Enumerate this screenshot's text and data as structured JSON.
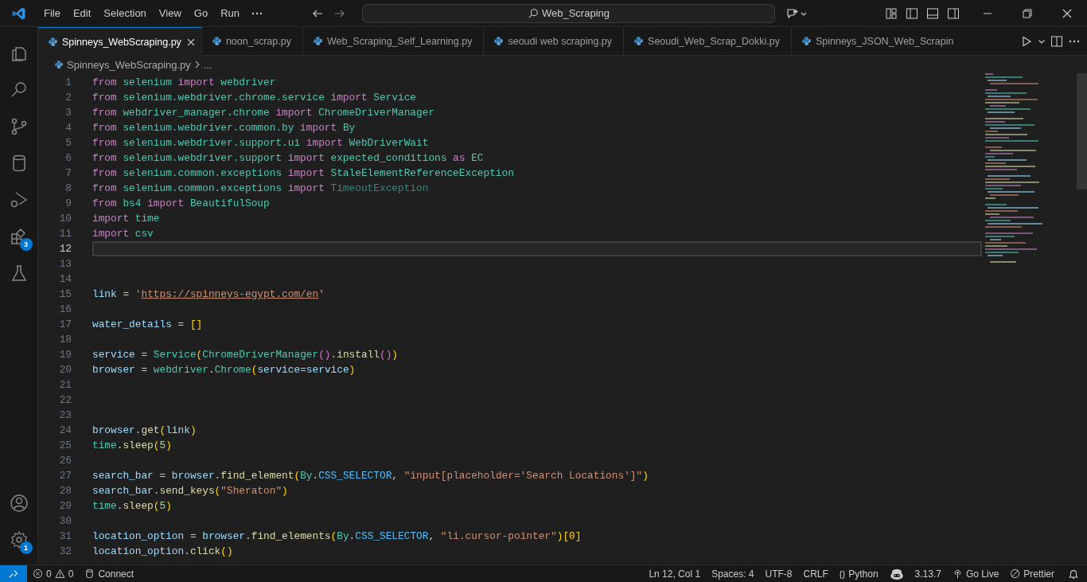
{
  "menu": [
    "File",
    "Edit",
    "Selection",
    "View",
    "Go",
    "Run"
  ],
  "search": {
    "value": "Web_Scraping"
  },
  "tabs": [
    {
      "label": "Spinneys_WebScraping.py",
      "selected": true
    },
    {
      "label": "noon_scrap.py",
      "selected": false
    },
    {
      "label": "Web_Scraping_Self_Learning.py",
      "selected": false
    },
    {
      "label": "seoudi web scraping.py",
      "selected": false
    },
    {
      "label": "Seoudi_Web_Scrap_Dokki.py",
      "selected": false
    },
    {
      "label": "Spinneys_JSON_Web_Scrapin",
      "selected": false
    }
  ],
  "breadcrumb": [
    "Spinneys_WebScraping.py",
    "..."
  ],
  "activity_badges": {
    "extensions": "3",
    "settings": "1"
  },
  "lines": [
    {
      "number": "1",
      "active": false,
      "tokens": [
        {
          "kind": "kw",
          "text": "from "
        },
        {
          "kind": "mod",
          "text": "selenium"
        },
        {
          "kind": "kw",
          "text": " import "
        },
        {
          "kind": "mod",
          "text": "webdriver"
        }
      ]
    },
    {
      "number": "2",
      "active": false,
      "tokens": [
        {
          "kind": "kw",
          "text": "from "
        },
        {
          "kind": "mod",
          "text": "selenium.webdriver.chrome.service"
        },
        {
          "kind": "kw",
          "text": " import "
        },
        {
          "kind": "mod",
          "text": "Service"
        }
      ]
    },
    {
      "number": "3",
      "active": false,
      "tokens": [
        {
          "kind": "kw",
          "text": "from "
        },
        {
          "kind": "mod",
          "text": "webdriver_manager.chrome"
        },
        {
          "kind": "kw",
          "text": " import "
        },
        {
          "kind": "mod",
          "text": "ChromeDriverManager"
        }
      ]
    },
    {
      "number": "4",
      "active": false,
      "tokens": [
        {
          "kind": "kw",
          "text": "from "
        },
        {
          "kind": "mod",
          "text": "selenium.webdriver.common.by"
        },
        {
          "kind": "kw",
          "text": " import "
        },
        {
          "kind": "mod",
          "text": "By"
        }
      ]
    },
    {
      "number": "5",
      "active": false,
      "tokens": [
        {
          "kind": "kw",
          "text": "from "
        },
        {
          "kind": "mod",
          "text": "selenium.webdriver.support.ui"
        },
        {
          "kind": "kw",
          "text": " import "
        },
        {
          "kind": "mod",
          "text": "WebDriverWait"
        }
      ]
    },
    {
      "number": "6",
      "active": false,
      "tokens": [
        {
          "kind": "kw",
          "text": "from "
        },
        {
          "kind": "mod",
          "text": "selenium.webdriver.support"
        },
        {
          "kind": "kw",
          "text": " import "
        },
        {
          "kind": "mod",
          "text": "expected_conditions"
        },
        {
          "kind": "kw",
          "text": " as "
        },
        {
          "kind": "mod",
          "text": "EC"
        }
      ]
    },
    {
      "number": "7",
      "active": false,
      "tokens": [
        {
          "kind": "kw",
          "text": "from "
        },
        {
          "kind": "mod",
          "text": "selenium.common.exceptions"
        },
        {
          "kind": "kw",
          "text": " import "
        },
        {
          "kind": "mod",
          "text": "StaleElementReferenceException"
        }
      ]
    },
    {
      "number": "8",
      "active": false,
      "tokens": [
        {
          "kind": "kw",
          "text": "from "
        },
        {
          "kind": "mod",
          "text": "selenium.common.exceptions"
        },
        {
          "kind": "kw",
          "text": " import "
        },
        {
          "kind": "dim",
          "text": "TimeoutException"
        }
      ]
    },
    {
      "number": "9",
      "active": false,
      "tokens": [
        {
          "kind": "kw",
          "text": "from "
        },
        {
          "kind": "mod",
          "text": "bs4"
        },
        {
          "kind": "kw",
          "text": " import "
        },
        {
          "kind": "mod",
          "text": "BeautifulSoup"
        }
      ]
    },
    {
      "number": "10",
      "active": false,
      "tokens": [
        {
          "kind": "kw",
          "text": "import "
        },
        {
          "kind": "mod",
          "text": "time"
        }
      ]
    },
    {
      "number": "11",
      "active": false,
      "tokens": [
        {
          "kind": "kw",
          "text": "import "
        },
        {
          "kind": "mod",
          "text": "csv"
        }
      ]
    },
    {
      "number": "12",
      "active": true
    },
    {
      "number": "13",
      "active": false
    },
    {
      "number": "14",
      "active": false
    },
    {
      "number": "15",
      "active": false,
      "tokens": [
        {
          "kind": "var",
          "text": "link"
        },
        {
          "kind": "op",
          "text": " = "
        },
        {
          "kind": "str",
          "text": "'"
        },
        {
          "kind": "url",
          "text": "https://spinneys-egypt.com/en"
        },
        {
          "kind": "str",
          "text": "'"
        }
      ]
    },
    {
      "number": "16",
      "active": false
    },
    {
      "number": "17",
      "active": false,
      "tokens": [
        {
          "kind": "var",
          "text": "water_details"
        },
        {
          "kind": "op",
          "text": " = "
        },
        {
          "kind": "p1",
          "text": "[]"
        }
      ]
    },
    {
      "number": "18",
      "active": false
    },
    {
      "number": "19",
      "active": false,
      "tokens": [
        {
          "kind": "var",
          "text": "service"
        },
        {
          "kind": "op",
          "text": " = "
        },
        {
          "kind": "mod",
          "text": "Service"
        },
        {
          "kind": "p1",
          "text": "("
        },
        {
          "kind": "mod",
          "text": "ChromeDriverManager"
        },
        {
          "kind": "p2",
          "text": "()"
        },
        {
          "kind": "op",
          "text": "."
        },
        {
          "kind": "fn",
          "text": "install"
        },
        {
          "kind": "p2",
          "text": "()"
        },
        {
          "kind": "p1",
          "text": ")"
        }
      ]
    },
    {
      "number": "20",
      "active": false,
      "tokens": [
        {
          "kind": "var",
          "text": "browser"
        },
        {
          "kind": "op",
          "text": " = "
        },
        {
          "kind": "mod",
          "text": "webdriver"
        },
        {
          "kind": "op",
          "text": "."
        },
        {
          "kind": "mod",
          "text": "Chrome"
        },
        {
          "kind": "p1",
          "text": "("
        },
        {
          "kind": "var",
          "text": "service"
        },
        {
          "kind": "op",
          "text": "="
        },
        {
          "kind": "var",
          "text": "service"
        },
        {
          "kind": "p1",
          "text": ")"
        }
      ]
    },
    {
      "number": "21",
      "active": false
    },
    {
      "number": "22",
      "active": false
    },
    {
      "number": "23",
      "active": false
    },
    {
      "number": "24",
      "active": false,
      "tokens": [
        {
          "kind": "var",
          "text": "browser"
        },
        {
          "kind": "op",
          "text": "."
        },
        {
          "kind": "fn",
          "text": "get"
        },
        {
          "kind": "p1",
          "text": "("
        },
        {
          "kind": "var",
          "text": "link"
        },
        {
          "kind": "p1",
          "text": ")"
        }
      ]
    },
    {
      "number": "25",
      "active": false,
      "tokens": [
        {
          "kind": "mod",
          "text": "time"
        },
        {
          "kind": "op",
          "text": "."
        },
        {
          "kind": "fn",
          "text": "sleep"
        },
        {
          "kind": "p1",
          "text": "("
        },
        {
          "kind": "num",
          "text": "5"
        },
        {
          "kind": "p1",
          "text": ")"
        }
      ]
    },
    {
      "number": "26",
      "active": false
    },
    {
      "number": "27",
      "active": false,
      "tokens": [
        {
          "kind": "var",
          "text": "search_bar"
        },
        {
          "kind": "op",
          "text": " = "
        },
        {
          "kind": "var",
          "text": "browser"
        },
        {
          "kind": "op",
          "text": "."
        },
        {
          "kind": "fn",
          "text": "find_element"
        },
        {
          "kind": "p1",
          "text": "("
        },
        {
          "kind": "mod",
          "text": "By"
        },
        {
          "kind": "op",
          "text": "."
        },
        {
          "kind": "const",
          "text": "CSS_SELECTOR"
        },
        {
          "kind": "op",
          "text": ", "
        },
        {
          "kind": "str",
          "text": "\"input[placeholder='Search Locations']\""
        },
        {
          "kind": "p1",
          "text": ")"
        }
      ]
    },
    {
      "number": "28",
      "active": false,
      "tokens": [
        {
          "kind": "var",
          "text": "search_bar"
        },
        {
          "kind": "op",
          "text": "."
        },
        {
          "kind": "fn",
          "text": "send_keys"
        },
        {
          "kind": "p1",
          "text": "("
        },
        {
          "kind": "str",
          "text": "\"Sheraton\""
        },
        {
          "kind": "p1",
          "text": ")"
        }
      ]
    },
    {
      "number": "29",
      "active": false,
      "tokens": [
        {
          "kind": "mod",
          "text": "time"
        },
        {
          "kind": "op",
          "text": "."
        },
        {
          "kind": "fn",
          "text": "sleep"
        },
        {
          "kind": "p1",
          "text": "("
        },
        {
          "kind": "num",
          "text": "5"
        },
        {
          "kind": "p1",
          "text": ")"
        }
      ]
    },
    {
      "number": "30",
      "active": false
    },
    {
      "number": "31",
      "active": false,
      "tokens": [
        {
          "kind": "var",
          "text": "location_option"
        },
        {
          "kind": "op",
          "text": " = "
        },
        {
          "kind": "var",
          "text": "browser"
        },
        {
          "kind": "op",
          "text": "."
        },
        {
          "kind": "fn",
          "text": "find_elements"
        },
        {
          "kind": "p1",
          "text": "("
        },
        {
          "kind": "mod",
          "text": "By"
        },
        {
          "kind": "op",
          "text": "."
        },
        {
          "kind": "const",
          "text": "CSS_SELECTOR"
        },
        {
          "kind": "op",
          "text": ", "
        },
        {
          "kind": "str",
          "text": "\"li.cursor-pointer\""
        },
        {
          "kind": "p1",
          "text": ")[0]"
        }
      ]
    },
    {
      "number": "32",
      "active": false,
      "tokens": [
        {
          "kind": "var",
          "text": "location_option"
        },
        {
          "kind": "op",
          "text": "."
        },
        {
          "kind": "fn",
          "text": "click"
        },
        {
          "kind": "p1",
          "text": "()"
        }
      ]
    }
  ],
  "status_bar": {
    "errors": "0",
    "warnings": "0",
    "connect": "Connect",
    "position": "Ln 12, Col 1",
    "spaces": "Spaces: 4",
    "encoding": "UTF-8",
    "eol": "CRLF",
    "language_icon": "{}",
    "language": "Python",
    "python_version": "3.13.7",
    "go_live": "Go Live",
    "prettier": "Prettier"
  }
}
